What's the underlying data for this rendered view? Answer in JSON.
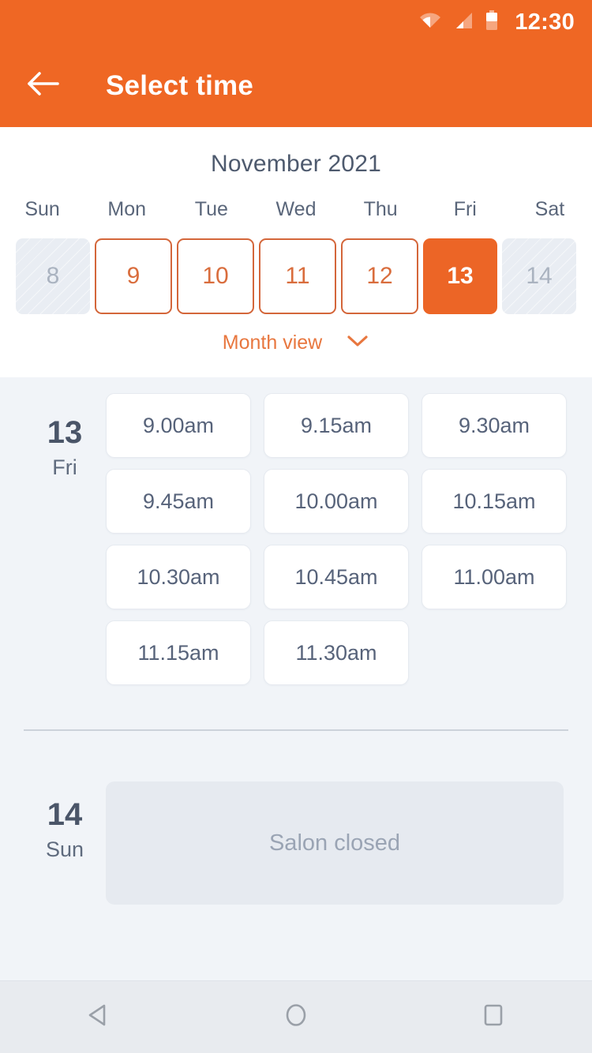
{
  "status_bar": {
    "time": "12:30",
    "icons": [
      "wifi-icon",
      "signal-icon",
      "battery-icon"
    ]
  },
  "app_bar": {
    "back_icon": "back-arrow-icon",
    "title": "Select time",
    "background_color": "#ef6724"
  },
  "calendar": {
    "month_title": "November 2021",
    "day_of_week_headers": [
      "Sun",
      "Mon",
      "Tue",
      "Wed",
      "Thu",
      "Fri",
      "Sat"
    ],
    "days": [
      {
        "number": "8",
        "state": "disabled"
      },
      {
        "number": "9",
        "state": "available"
      },
      {
        "number": "10",
        "state": "available"
      },
      {
        "number": "11",
        "state": "available"
      },
      {
        "number": "12",
        "state": "available"
      },
      {
        "number": "13",
        "state": "selected"
      },
      {
        "number": "14",
        "state": "disabled"
      }
    ],
    "month_view_toggle": {
      "label": "Month view",
      "icon": "chevron-down-icon"
    },
    "accent_color": "#ec6526",
    "outline_color": "#d4663a"
  },
  "schedule": [
    {
      "day_number": "13",
      "day_of_week": "Fri",
      "slots": [
        "9.00am",
        "9.15am",
        "9.30am",
        "9.45am",
        "10.00am",
        "10.15am",
        "10.30am",
        "10.45am",
        "11.00am",
        "11.15am",
        "11.30am"
      ]
    },
    {
      "day_number": "14",
      "day_of_week": "Sun",
      "closed_message": "Salon closed"
    }
  ],
  "nav_bar": {
    "items": [
      {
        "icon": "android-back-icon"
      },
      {
        "icon": "android-home-icon"
      },
      {
        "icon": "android-recents-icon"
      }
    ]
  }
}
